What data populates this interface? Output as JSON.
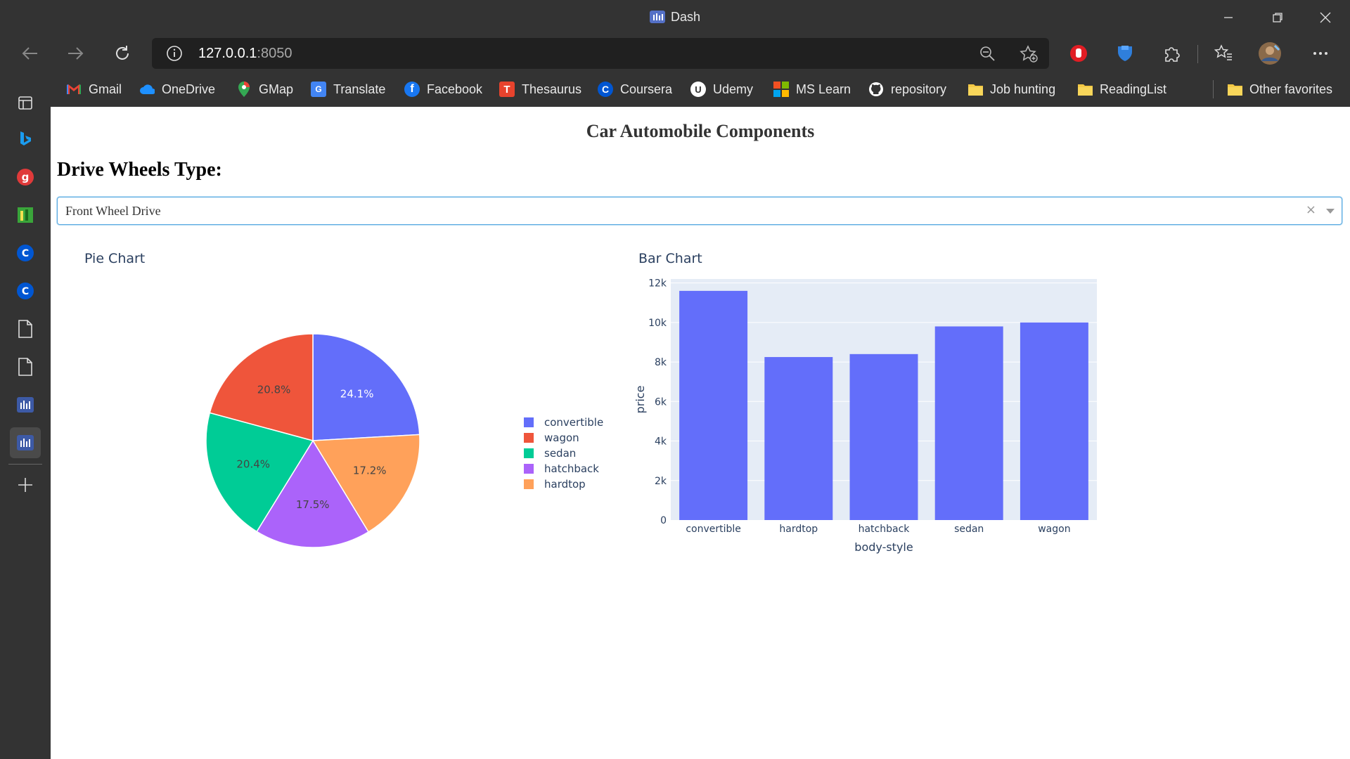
{
  "window": {
    "title": "Dash"
  },
  "address_bar": {
    "host": "127.0.0.1",
    "port": ":8050"
  },
  "bookmarks": [
    {
      "label": "Gmail",
      "icon": "gmail-icon"
    },
    {
      "label": "OneDrive",
      "icon": "onedrive-icon"
    },
    {
      "label": "GMap",
      "icon": "map-pin-icon"
    },
    {
      "label": "Translate",
      "icon": "translate-icon"
    },
    {
      "label": "Facebook",
      "icon": "facebook-icon"
    },
    {
      "label": "Thesaurus",
      "icon": "thesaurus-icon"
    },
    {
      "label": "Coursera",
      "icon": "coursera-icon"
    },
    {
      "label": "Udemy",
      "icon": "udemy-icon"
    },
    {
      "label": "MS Learn",
      "icon": "microsoft-icon"
    },
    {
      "label": "repository",
      "icon": "github-icon"
    },
    {
      "label": "Job hunting",
      "icon": "folder-icon"
    },
    {
      "label": "ReadingList",
      "icon": "folder-icon"
    },
    {
      "label": "Other favorites",
      "icon": "folder-icon"
    }
  ],
  "app": {
    "title": "Car Automobile Components",
    "section_label": "Drive Wheels Type:",
    "dropdown_value": "Front Wheel Drive",
    "dropdown_clear": "×"
  },
  "colors": {
    "plotly_blue": "#636efa",
    "plotly_red": "#ef553b",
    "plotly_green": "#00cc96",
    "plotly_purple": "#ab63fa",
    "plotly_orange": "#ffa15a",
    "plot_bg": "#e5ecf6"
  },
  "chart_data": [
    {
      "type": "pie",
      "title": "Pie Chart",
      "labels": [
        "convertible",
        "wagon",
        "sedan",
        "hatchback",
        "hardtop"
      ],
      "values": [
        24.1,
        20.8,
        20.4,
        17.5,
        17.2
      ],
      "slice_order": [
        "convertible",
        "hardtop",
        "hatchback",
        "sedan",
        "wagon"
      ],
      "legend_position": "right"
    },
    {
      "type": "bar",
      "title": "Bar Chart",
      "categories": [
        "convertible",
        "hardtop",
        "hatchback",
        "sedan",
        "wagon"
      ],
      "values": [
        11600,
        8250,
        8400,
        9800,
        10000
      ],
      "xlabel": "body-style",
      "ylabel": "price",
      "ylim": [
        0,
        12200
      ],
      "yticks": [
        0,
        2000,
        4000,
        6000,
        8000,
        10000,
        12000
      ],
      "ytick_labels": [
        "0",
        "2k",
        "4k",
        "6k",
        "8k",
        "10k",
        "12k"
      ]
    }
  ]
}
